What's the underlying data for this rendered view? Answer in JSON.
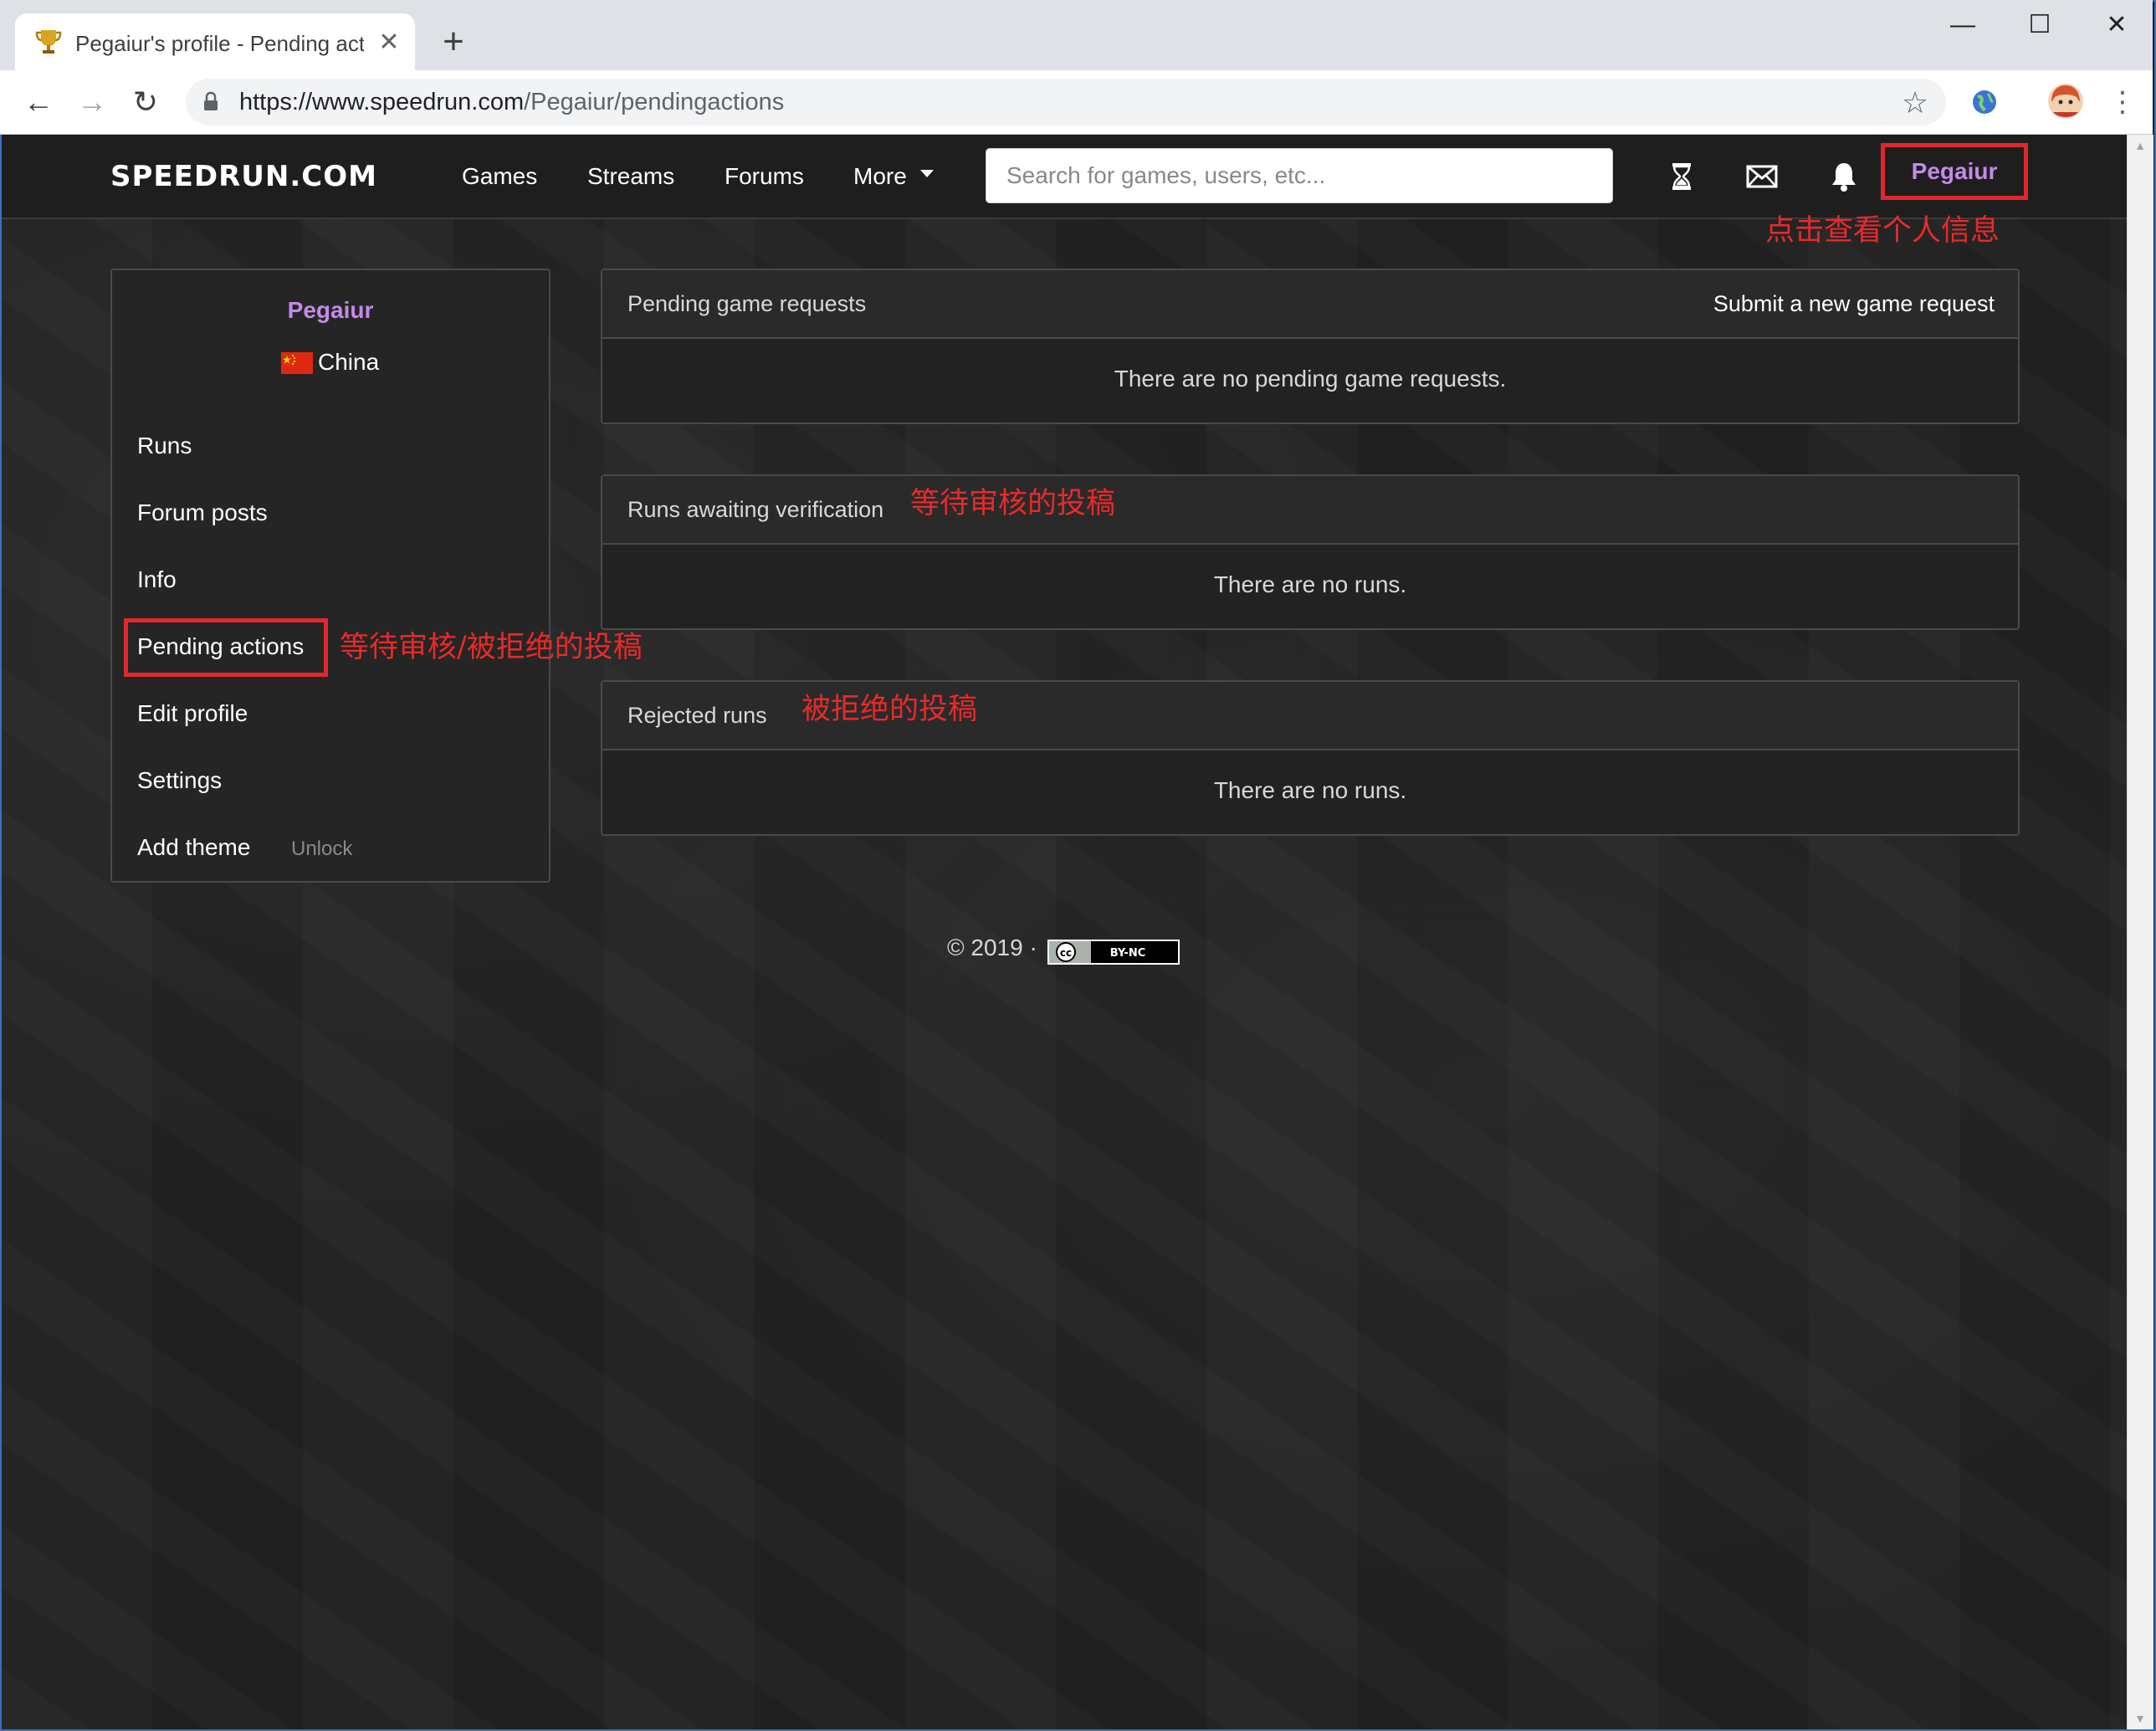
{
  "browser": {
    "tab_title": "Pegaiur's profile - Pending act",
    "url_host": "https://www.speedrun.com",
    "url_path": "/Pegaiur/pendingactions",
    "new_tab_icon": "+",
    "close_icon": "✕"
  },
  "site": {
    "logo": "SPEEDRUN.COM",
    "nav": {
      "games": "Games",
      "streams": "Streams",
      "forums": "Forums",
      "more": "More"
    },
    "search_placeholder": "Search for games, users, etc...",
    "user_link": "Pegaiur",
    "user_color": "#c48ae8"
  },
  "sidebar": {
    "username": "Pegaiur",
    "country": "China",
    "items": [
      {
        "label": "Runs"
      },
      {
        "label": "Forum posts"
      },
      {
        "label": "Info"
      },
      {
        "label": "Pending actions"
      },
      {
        "label": "Edit profile"
      },
      {
        "label": "Settings"
      },
      {
        "label": "Add theme"
      }
    ],
    "unlock_label": "Unlock"
  },
  "panels": {
    "game_requests": {
      "title": "Pending game requests",
      "action": "Submit a new game request",
      "empty": "There are no pending game requests."
    },
    "awaiting": {
      "title": "Runs awaiting verification",
      "empty": "There are no runs."
    },
    "rejected": {
      "title": "Rejected runs",
      "empty": "There are no runs."
    }
  },
  "annotations": {
    "profile": "点击查看个人信息",
    "pending": "等待审核/被拒绝的投稿",
    "awaiting": "等待审核的投稿",
    "rejected": "被拒绝的投稿"
  },
  "footer": {
    "copyright": "© 2019 ·",
    "license": "BY-NC"
  },
  "colors": {
    "annotation_red": "#e82a2a",
    "highlight_red": "#e0282c"
  }
}
